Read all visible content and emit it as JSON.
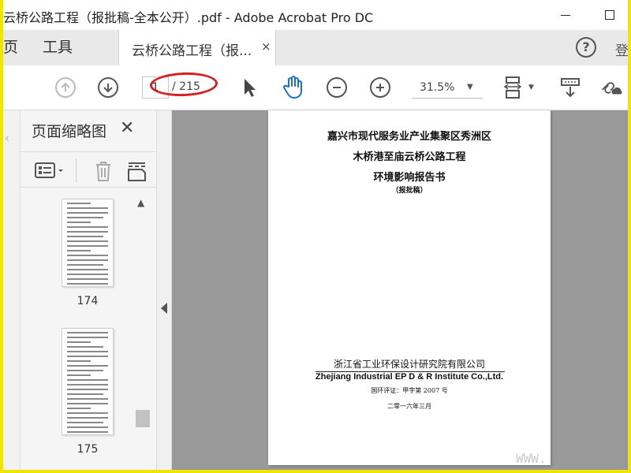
{
  "window": {
    "title": "云桥公路工程（报批稿-全本公开）.pdf - Adobe Acrobat Pro DC",
    "minimize_icon": "minimize-icon",
    "maximize_icon": "maximize-icon"
  },
  "tabs": {
    "home": "页",
    "tools": "工具",
    "document": "云桥公路工程（报...",
    "close": "×",
    "help": "?",
    "signin": "登"
  },
  "toolbar": {
    "current_page": "1",
    "total_pages": "/ 215",
    "zoom": "31.5%"
  },
  "thumbnails": {
    "title": "页面缩略图",
    "close": "✕",
    "pages": [
      "174",
      "175"
    ]
  },
  "document_page": {
    "line1": "嘉兴市现代服务业产业集聚区秀洲区",
    "line2": "木桥港至庙云桥公路工程",
    "line3": "环境影响报告书",
    "line4": "（报批稿）",
    "org_cn": "浙江省工业环保设计研究院有限公司",
    "org_en": "Zhejiang Industrial EP D & R Institute Co.,Ltd.",
    "license": "国环评证：甲字第 2007 号",
    "date": "二零一六年三月"
  },
  "watermark": "WWW.",
  "colors": {
    "highlight_ellipse": "#d42020",
    "screen_border": "#f0e400"
  }
}
